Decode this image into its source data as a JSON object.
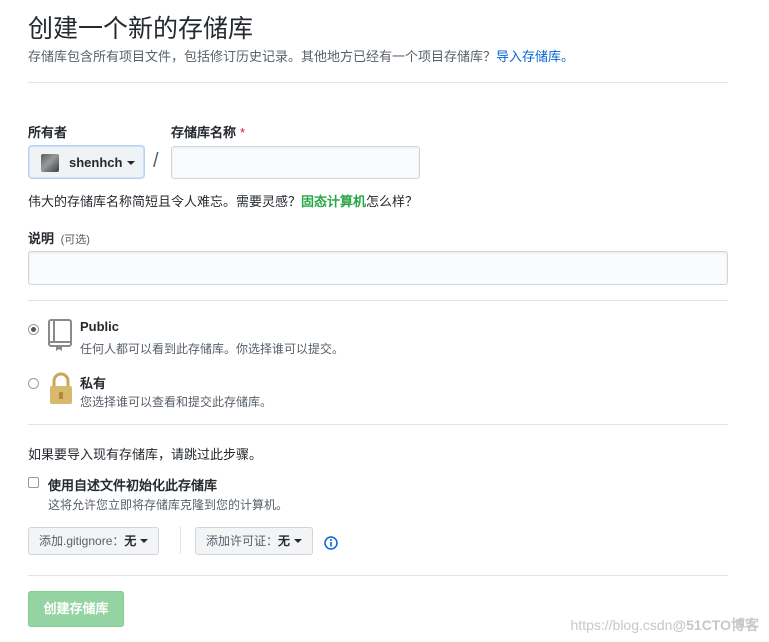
{
  "header": {
    "title": "创建一个新的存储库",
    "subtitle": "存储库包含所有项目文件，包括修订历史记录。其他地方已经有一个项目存储库？",
    "import_link": "导入存储库。"
  },
  "owner": {
    "label": "所有者",
    "name": "shenhch"
  },
  "repo": {
    "label": "存储库名称",
    "required_mark": "*",
    "value": "",
    "slash": "/"
  },
  "hint": {
    "prefix": "伟大的存储库名称简短且令人难忘。需要灵感？",
    "suggestion": "固态计算机",
    "suffix": "怎么样？"
  },
  "description": {
    "label": "说明",
    "optional": "(可选)",
    "value": ""
  },
  "visibility": {
    "public": {
      "title": "Public",
      "desc": "任何人都可以看到此存储库。你选择谁可以提交。",
      "selected": true,
      "icon": "repo-book-icon"
    },
    "private": {
      "title": "私有",
      "desc": "您选择谁可以查看和提交此存储库。",
      "selected": false,
      "icon": "lock-icon"
    }
  },
  "init": {
    "skip_note": "如果要导入现有存储库，请跳过此步骤。",
    "readme_label": "使用自述文件初始化此存储库",
    "readme_desc": "这将允许您立即将存储库克隆到您的计算机。",
    "readme_checked": false
  },
  "options": {
    "gitignore_label": "添加.gitignore：",
    "gitignore_value": "无",
    "license_label": "添加许可证：",
    "license_value": "无"
  },
  "submit": {
    "label": "创建存储库"
  },
  "watermark": {
    "url": "https://blog.csdn",
    "brand": "@51CTO博客"
  },
  "colors": {
    "link": "#0366d6",
    "suggestion": "#28a745",
    "create_button": "#94d3a2",
    "required": "#cb2431"
  }
}
